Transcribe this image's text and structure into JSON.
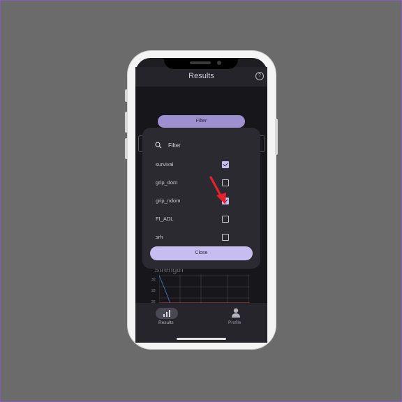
{
  "header": {
    "title": "Results",
    "help_icon": "help-circle-icon",
    "help_glyph": "?"
  },
  "background": {
    "filter_button_label": "Filter"
  },
  "chart": {
    "title": "Strength",
    "y_ticks": [
      "30",
      "28",
      "26"
    ],
    "series_color": "#3a6ea5",
    "baseline_color": "#c0392b"
  },
  "dialog": {
    "search_placeholder": "Filter",
    "items": [
      {
        "label": "survival",
        "checked": true
      },
      {
        "label": "grip_dom",
        "checked": false
      },
      {
        "label": "grip_ndom",
        "checked": true
      },
      {
        "label": "FI_ADL",
        "checked": false
      },
      {
        "label": "srh",
        "checked": false
      }
    ],
    "close_label": "Close"
  },
  "annotation": {
    "arrow_color": "#e8202a"
  },
  "bottom_nav": {
    "results_label": "Results",
    "profile_label": "Profile",
    "results_icon": "bar-chart-icon",
    "profile_icon": "person-icon"
  }
}
